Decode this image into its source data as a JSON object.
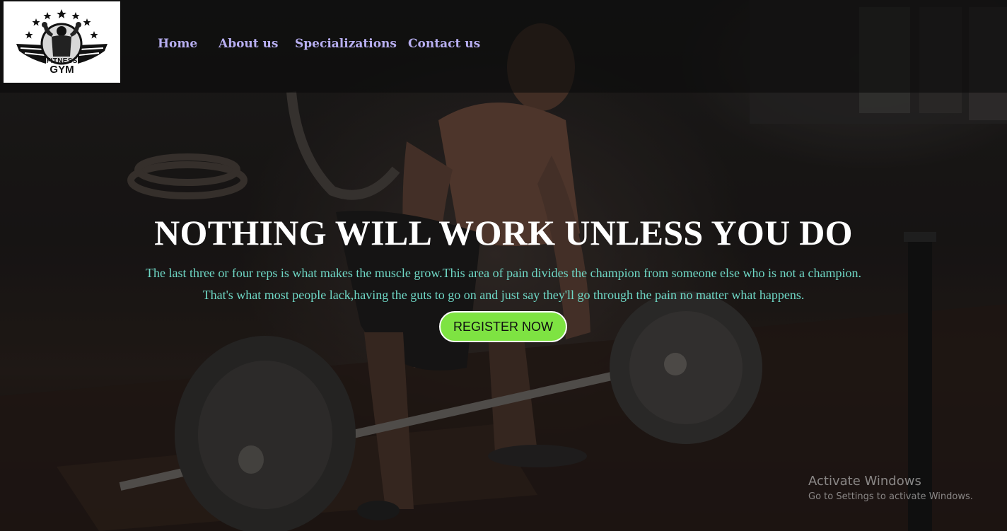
{
  "brand": {
    "logo_line1": "FITNESS",
    "logo_line2": "GYM"
  },
  "nav": {
    "items": [
      {
        "label": "Home"
      },
      {
        "label": "About us"
      },
      {
        "label": "Specializations"
      },
      {
        "label": "Contact us"
      }
    ]
  },
  "hero": {
    "headline": "NOTHING WILL WORK UNLESS YOU DO",
    "line1": "The last three or four reps is what makes the muscle grow.This area of pain divides the champion from someone else who is not a champion.",
    "line2": "That's what most people lack,having the guts to go on and just say they'll go through the pain no matter what happens.",
    "register_label": "REGISTER NOW"
  },
  "windows_notice": {
    "title": "Activate Windows",
    "subtitle": "Go to Settings to activate Windows."
  },
  "colors": {
    "nav_text": "#b7aef0",
    "subtext": "#6fd8c6",
    "button_bg": "#7ee342",
    "headline": "#ffffff"
  },
  "icons": {
    "logo": "gym-logo-icon"
  }
}
